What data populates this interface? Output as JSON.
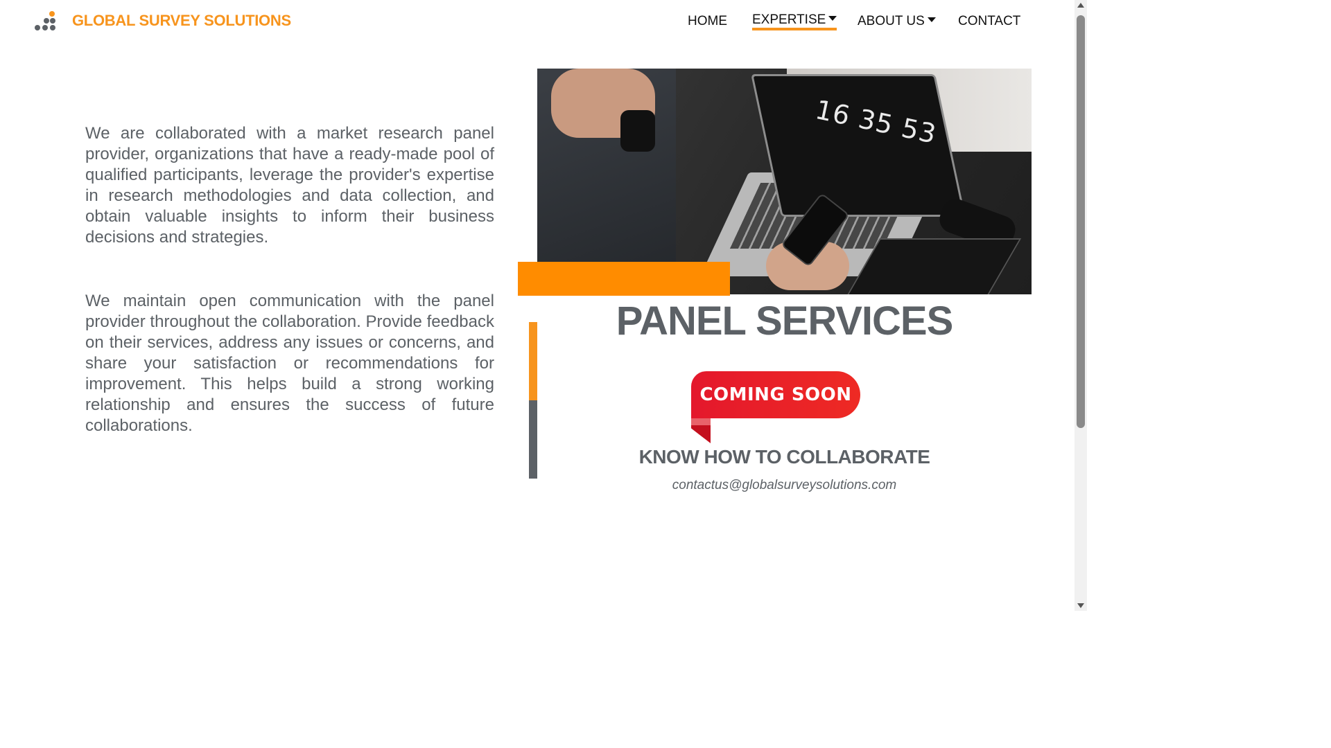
{
  "header": {
    "brand": "GLOBAL SURVEY SOLUTIONS",
    "logo_icon": "dots-logo-icon"
  },
  "nav": {
    "items": [
      {
        "label": "HOME",
        "dropdown": false,
        "active": false
      },
      {
        "label": "EXPERTISE",
        "dropdown": true,
        "active": true
      },
      {
        "label": "ABOUT US",
        "dropdown": true,
        "active": false
      },
      {
        "label": "CONTACT",
        "dropdown": false,
        "active": false
      }
    ]
  },
  "content": {
    "paragraph_1": "We are collaborated with a market research panel provider, organizations that have a ready-made pool of qualified participants, leverage the provider's expertise in research methodologies and data collection, and obtain valuable insights to inform their business decisions and strategies.",
    "paragraph_2": "We maintain open communication with the panel provider throughout the collaboration. Provide feedback on their services, address any issues or concerns, and share your satisfaction or recommendations for improvement. This helps build a strong working relationship and ensures the success of future collaborations."
  },
  "panel": {
    "title": "PANEL SERVICES",
    "badge": "COMING SOON",
    "subtitle": "KNOW HOW TO COLLABORATE",
    "email": "contactus@globalsurveysolutions.com",
    "photo_clock_text": "16 35 53"
  },
  "colors": {
    "accent": "#f7941d",
    "text_grey": "#5c6166",
    "badge_red": "#e4182c"
  }
}
